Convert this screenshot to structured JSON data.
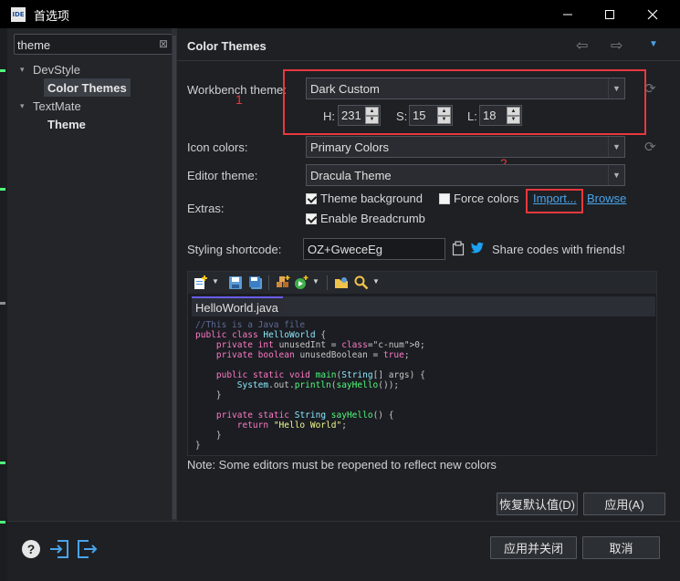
{
  "window": {
    "app_icon_text": "IDE",
    "title": "首选项",
    "minimize_glyph": "—",
    "maximize_glyph": "☐",
    "close_glyph": "✕"
  },
  "sidebar": {
    "search_value": "theme",
    "search_clear_glyph": "⊠",
    "groups": [
      {
        "label": "DevStyle",
        "items": [
          {
            "label": "Color Themes",
            "selected": true
          }
        ]
      },
      {
        "label": "TextMate",
        "items": [
          {
            "label": "Theme",
            "selected": false
          }
        ]
      }
    ]
  },
  "header": {
    "title": "Color Themes",
    "back_glyph": "⇦",
    "forward_glyph": "⇨",
    "menu_glyph": "▼"
  },
  "form": {
    "workbench_theme_label": "Workbench theme:",
    "workbench_theme_value": "Dark Custom",
    "h_label": "H:",
    "h_value": "231",
    "s_label": "S:",
    "s_value": "15",
    "l_label": "L:",
    "l_value": "18",
    "icon_colors_label": "Icon colors:",
    "icon_colors_value": "Primary Colors",
    "editor_theme_label": "Editor theme:",
    "editor_theme_value": "Dracula Theme",
    "extras_label": "Extras:",
    "theme_background_label": "Theme background",
    "theme_background_checked": true,
    "force_colors_label": "Force colors",
    "force_colors_checked": false,
    "enable_breadcrumb_label": "Enable Breadcrumb",
    "enable_breadcrumb_checked": true,
    "import_link": "Import...",
    "browse_link": "Browse",
    "styling_shortcode_label": "Styling shortcode:",
    "styling_shortcode_value": "OZ+GweceEg",
    "share_text": "Share codes with friends!",
    "refresh_glyph": "⟳"
  },
  "annotations": {
    "one": "1",
    "two": "2",
    "color": "#e8383d"
  },
  "preview": {
    "tab_label": "HelloWorld.java",
    "code_lines": [
      "//This is a Java file",
      "public class HelloWorld {",
      "    private int unusedInt = 0;",
      "    private boolean unusedBoolean = true;",
      "",
      "    public static void main(String[] args) {",
      "        System.out.println(sayHello());",
      "    }",
      "",
      "    private static String sayHello() {",
      "        return \"Hello World\";",
      "    }",
      "}"
    ]
  },
  "note": "Note: Some editors must be reopened to reflect new colors",
  "buttons": {
    "restore_defaults": "恢复默认值(D)",
    "apply": "应用(A)",
    "apply_close": "应用并关闭",
    "cancel": "取消"
  },
  "footer": {
    "help_glyph": "?"
  },
  "colors": {
    "accent_link": "#4aa3e8",
    "tab_accent": "#6a5df0"
  }
}
